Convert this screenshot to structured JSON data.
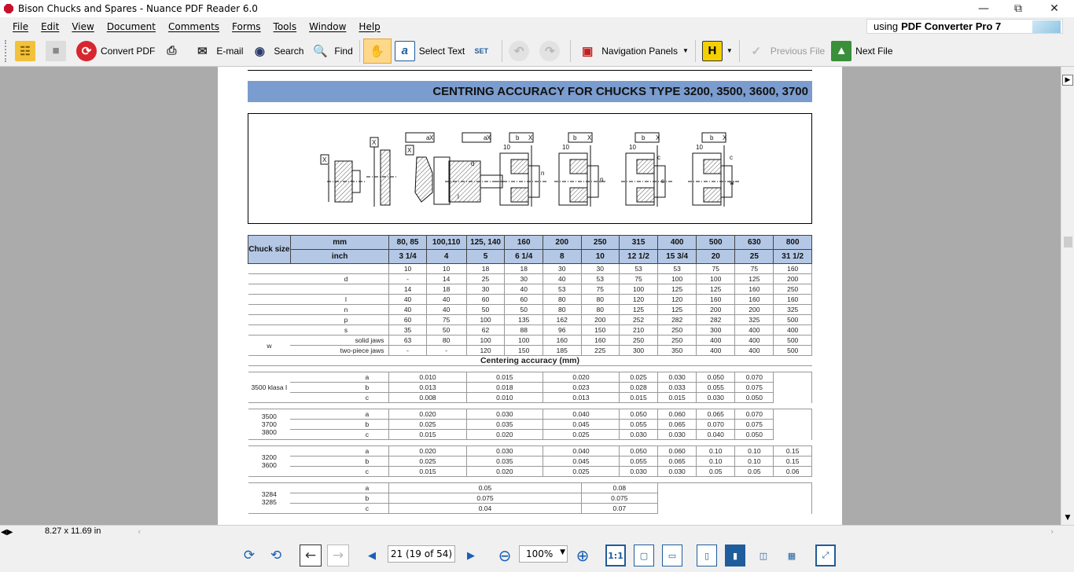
{
  "window": {
    "title": "Bison Chucks and Spares - Nuance PDF Reader 6.0",
    "controls": [
      "minimize",
      "restore",
      "close"
    ]
  },
  "menu": [
    "File",
    "Edit",
    "View",
    "Document",
    "Comments",
    "Forms",
    "Tools",
    "Window",
    "Help"
  ],
  "promo": {
    "prefix": "using",
    "product": "PDF Converter Pro 7"
  },
  "toolbar": {
    "convert": "Convert PDF",
    "email": "E-mail",
    "search": "Search",
    "find": "Find",
    "select_text": "Select Text",
    "set": "SET",
    "nav_panels": "Navigation Panels",
    "prev_file": "Previous File",
    "next_file": "Next File"
  },
  "status": {
    "page_size": "8.27 x 11.69 in"
  },
  "nav": {
    "page_field": "21 (19 of 54)",
    "zoom": "100%",
    "actual_size": "1:1"
  },
  "doc": {
    "heading": "CENTRING ACCURACY FOR CHUCKS TYPE 3200, 3500, 3600, 3700",
    "drawing_labels": [
      "X",
      "X",
      "X",
      "a",
      "X",
      "a",
      "X",
      "b",
      "X",
      "b",
      "X",
      "b",
      "X",
      "b",
      "X",
      "10",
      "10",
      "10",
      "10",
      "d",
      "n",
      "p",
      "s",
      "w",
      "l",
      "c",
      "c"
    ],
    "size_header": {
      "chuck_size": "Chuck size",
      "mm": "mm",
      "inch": "inch",
      "mm_values": [
        "80, 85",
        "100,110",
        "125, 140",
        "160",
        "200",
        "250",
        "315",
        "400",
        "500",
        "630",
        "800"
      ],
      "inch_values": [
        "3 1/4",
        "4",
        "5",
        "6 1/4",
        "8",
        "10",
        "12 1/2",
        "15 3/4",
        "20",
        "25",
        "31 1/2"
      ]
    },
    "dims": [
      {
        "label": "",
        "sub": "",
        "values": [
          "10",
          "10",
          "18",
          "18",
          "30",
          "30",
          "53",
          "53",
          "75",
          "75",
          "160"
        ]
      },
      {
        "label": "d",
        "sub": "",
        "values": [
          "-",
          "14",
          "25",
          "30",
          "40",
          "53",
          "75",
          "100",
          "100",
          "125",
          "200"
        ]
      },
      {
        "label": "",
        "sub": "",
        "values": [
          "14",
          "18",
          "30",
          "40",
          "53",
          "75",
          "100",
          "125",
          "125",
          "160",
          "250"
        ]
      },
      {
        "label": "l",
        "sub": "",
        "values": [
          "40",
          "40",
          "60",
          "60",
          "80",
          "80",
          "120",
          "120",
          "160",
          "160",
          "160"
        ]
      },
      {
        "label": "n",
        "sub": "",
        "values": [
          "40",
          "40",
          "50",
          "50",
          "80",
          "80",
          "125",
          "125",
          "200",
          "200",
          "325"
        ]
      },
      {
        "label": "p",
        "sub": "",
        "values": [
          "60",
          "75",
          "100",
          "135",
          "162",
          "200",
          "252",
          "282",
          "282",
          "325",
          "500"
        ]
      },
      {
        "label": "s",
        "sub": "",
        "values": [
          "35",
          "50",
          "62",
          "88",
          "96",
          "150",
          "210",
          "250",
          "300",
          "400",
          "400"
        ]
      },
      {
        "label": "w",
        "sub": "solid jaws",
        "values": [
          "63",
          "80",
          "100",
          "100",
          "160",
          "160",
          "250",
          "250",
          "400",
          "400",
          "500"
        ]
      },
      {
        "label": "",
        "sub": "two-piece jaws",
        "values": [
          "-",
          "-",
          "120",
          "150",
          "185",
          "225",
          "300",
          "350",
          "400",
          "400",
          "500"
        ]
      }
    ],
    "accuracy_caption": "Centering accuracy (mm)",
    "acc_groups": [
      {
        "name": [
          "3500 klasa I"
        ],
        "rows": [
          {
            "k": "a",
            "v": [
              "0.010",
              "0.015",
              "0.020",
              "0.025",
              "0.030",
              "0.050",
              "0.070",
              ""
            ]
          },
          {
            "k": "b",
            "v": [
              "0.013",
              "0.018",
              "0.023",
              "0.028",
              "0.033",
              "0.055",
              "0.075",
              ""
            ]
          },
          {
            "k": "c",
            "v": [
              "0.008",
              "0.010",
              "0.013",
              "0.015",
              "0.015",
              "0.030",
              "0.050",
              ""
            ]
          }
        ]
      },
      {
        "name": [
          "3500",
          "3700",
          "3800"
        ],
        "rows": [
          {
            "k": "a",
            "v": [
              "0.020",
              "0.030",
              "0.040",
              "0.050",
              "0.060",
              "0.065",
              "0.070",
              ""
            ]
          },
          {
            "k": "b",
            "v": [
              "0.025",
              "0.035",
              "0.045",
              "0.055",
              "0.065",
              "0.070",
              "0.075",
              ""
            ]
          },
          {
            "k": "c",
            "v": [
              "0.015",
              "0.020",
              "0.025",
              "0.030",
              "0.030",
              "0.040",
              "0.050",
              ""
            ]
          }
        ]
      },
      {
        "name": [
          "3200",
          "3600"
        ],
        "rows": [
          {
            "k": "a",
            "v": [
              "0.020",
              "0.030",
              "0.040",
              "0.050",
              "0.060",
              "0.10",
              "0.10",
              "0.15"
            ]
          },
          {
            "k": "b",
            "v": [
              "0.025",
              "0.035",
              "0.045",
              "0.055",
              "0.065",
              "0.10",
              "0.10",
              "0.15"
            ]
          },
          {
            "k": "c",
            "v": [
              "0.015",
              "0.020",
              "0.025",
              "0.030",
              "0.030",
              "0.05",
              "0.05",
              "0.06"
            ]
          }
        ]
      }
    ],
    "last_group": {
      "name": [
        "3284",
        "3285"
      ],
      "rows": [
        {
          "k": "a",
          "v1": "0.05",
          "v2": "0.08"
        },
        {
          "k": "b",
          "v1": "0.075",
          "v2": "0.075"
        },
        {
          "k": "c",
          "v1": "0.04",
          "v2": "0.07"
        }
      ]
    }
  }
}
